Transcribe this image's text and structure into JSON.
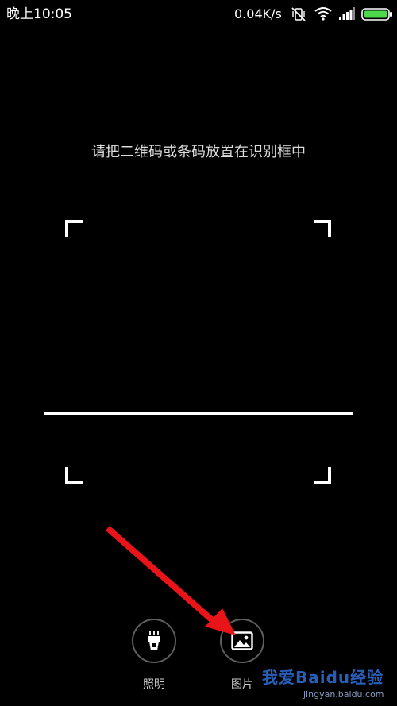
{
  "status_bar": {
    "time": "晚上10:05",
    "network_speed": "0.04K/s",
    "icons": [
      "vibrate-off-icon",
      "wifi-icon",
      "signal-icon",
      "battery-icon"
    ],
    "battery_color": "#4cd84c"
  },
  "scanner": {
    "prompt": "请把二维码或条码放置在识别框中"
  },
  "actions": {
    "light_label": "照明",
    "light_icon": "flashlight-icon",
    "gallery_label": "图片",
    "gallery_icon": "image-icon"
  },
  "annotation": {
    "arrow_color": "#e8141a"
  },
  "watermark": {
    "text": "我爱Baidu经验",
    "url": "jingyan.baidu.com"
  }
}
